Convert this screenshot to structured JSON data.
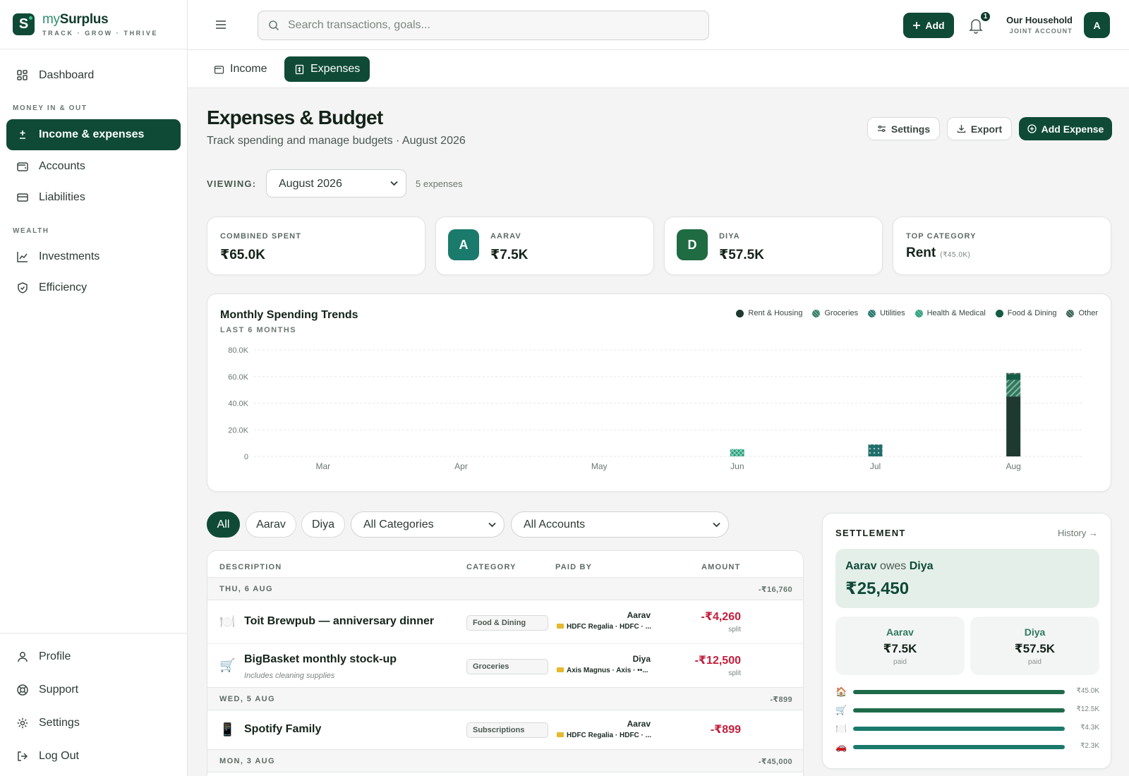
{
  "brand": {
    "name_a": "my",
    "name_b": "Surplus",
    "tagline": "TRACK · GROW · THRIVE",
    "logo_letter": "S"
  },
  "sidebar": {
    "dashboard": "Dashboard",
    "section_money": "MONEY IN & OUT",
    "income_expenses": "Income & expenses",
    "accounts": "Accounts",
    "liabilities": "Liabilities",
    "section_wealth": "WEALTH",
    "investments": "Investments",
    "efficiency": "Efficiency",
    "profile": "Profile",
    "support": "Support",
    "settings": "Settings",
    "logout": "Log Out"
  },
  "topbar": {
    "search_placeholder": "Search transactions, goals...",
    "add_label": "Add",
    "notification_count": "1",
    "household_name": "Our Household",
    "household_sub": "JOINT ACCOUNT",
    "avatar_letter": "A"
  },
  "tabs": {
    "income": "Income",
    "expenses": "Expenses"
  },
  "header": {
    "title": "Expenses & Budget",
    "subtitle": "Track spending and manage budgets · August 2026",
    "settings_btn": "Settings",
    "export_btn": "Export",
    "add_expense_btn": "Add Expense"
  },
  "viewing": {
    "label": "VIEWING:",
    "selected": "August 2026",
    "count": "5 expenses"
  },
  "stats": {
    "combined_label": "COMBINED SPENT",
    "combined_value": "₹65.0K",
    "aarav_label": "AARAV",
    "aarav_value": "₹7.5K",
    "aarav_initial": "A",
    "diya_label": "DIYA",
    "diya_value": "₹57.5K",
    "diya_initial": "D",
    "top_label": "TOP CATEGORY",
    "top_value": "Rent",
    "top_amount": "(₹45.0K)"
  },
  "colors": {
    "primary": "#0f4a37",
    "teal": "#1a7a6c",
    "expense": "#c21e3c",
    "rent": "#1e3a30"
  },
  "chart_data": {
    "type": "bar",
    "title": "Monthly Spending Trends",
    "subtitle": "LAST 6 MONTHS",
    "categories": [
      "Mar",
      "Apr",
      "May",
      "Jun",
      "Jul",
      "Aug"
    ],
    "ylim": [
      0,
      80000
    ],
    "yticks": [
      "0",
      "20.0K",
      "40.0K",
      "60.0K",
      "80.0K"
    ],
    "ytick_values": [
      0,
      20000,
      40000,
      60000,
      80000
    ],
    "stacked": true,
    "legend_position": "top-right",
    "series": [
      {
        "name": "Rent & Housing",
        "color": "#1e3a30",
        "pattern": "solid",
        "values": [
          0,
          0,
          0,
          0,
          0,
          45000
        ]
      },
      {
        "name": "Groceries",
        "color": "#2e7a5e",
        "pattern": "hatch",
        "values": [
          0,
          0,
          0,
          0,
          0,
          12500
        ]
      },
      {
        "name": "Utilities",
        "color": "#1f6e6a",
        "pattern": "dots",
        "values": [
          0,
          0,
          0,
          0,
          9000,
          0
        ]
      },
      {
        "name": "Health & Medical",
        "color": "#22a07a",
        "pattern": "cross",
        "values": [
          0,
          0,
          0,
          5500,
          0,
          0
        ]
      },
      {
        "name": "Food & Dining",
        "color": "#145c43",
        "pattern": "solid",
        "values": [
          0,
          0,
          0,
          0,
          0,
          4260
        ]
      },
      {
        "name": "Other",
        "color": "#3b5a52",
        "pattern": "hatch",
        "values": [
          0,
          0,
          0,
          0,
          0,
          899
        ]
      }
    ]
  },
  "filters": {
    "all": "All",
    "aarav": "Aarav",
    "diya": "Diya",
    "category": "All Categories",
    "account": "All Accounts"
  },
  "table": {
    "headers": {
      "description": "DESCRIPTION",
      "category": "CATEGORY",
      "paid_by": "PAID BY",
      "amount": "AMOUNT"
    },
    "groups": [
      {
        "date": "THU, 6 AUG",
        "total": "-₹16,760"
      },
      {
        "date": "WED, 5 AUG",
        "total": "-₹899"
      },
      {
        "date": "MON, 3 AUG",
        "total": "-₹45,000"
      }
    ],
    "rows": [
      {
        "icon": "🍽️",
        "desc": "Toit Brewpub — anniversary dinner",
        "note": "",
        "category": "Food & Dining",
        "payer": "Aarav",
        "account": "HDFC Regalia · HDFC · ...",
        "amount": "-₹4,260",
        "split": "split"
      },
      {
        "icon": "🛒",
        "desc": "BigBasket monthly stock-up",
        "note": "Includes cleaning supplies",
        "category": "Groceries",
        "payer": "Diya",
        "account": "Axis Magnus · Axis · ••...",
        "amount": "-₹12,500",
        "split": "split"
      },
      {
        "icon": "📱",
        "desc": "Spotify Family",
        "note": "",
        "category": "Subscriptions",
        "payer": "Aarav",
        "account": "HDFC Regalia · HDFC · ...",
        "amount": "-₹899",
        "split": ""
      }
    ]
  },
  "settlement": {
    "title": "SETTLEMENT",
    "history": "History →",
    "debtor": "Aarav",
    "owes": "owes",
    "creditor": "Diya",
    "amount": "₹25,450",
    "aarav_name": "Aarav",
    "aarav_paid": "₹7.5K",
    "paid_label": "paid",
    "diya_name": "Diya",
    "diya_paid": "₹57.5K",
    "categories": [
      {
        "icon": "🏠",
        "value": "₹45.0K",
        "fraction": 1.0,
        "color": "#1e6b4a"
      },
      {
        "icon": "🛒",
        "value": "₹12.5K",
        "fraction": 1.0,
        "color": "#1e6b4a"
      },
      {
        "icon": "🍽️",
        "value": "₹4.3K",
        "fraction": 1.0,
        "color": "#1a7a6c"
      },
      {
        "icon": "🚗",
        "value": "₹2.3K",
        "fraction": 1.0,
        "color": "#1a7a6c"
      }
    ]
  }
}
